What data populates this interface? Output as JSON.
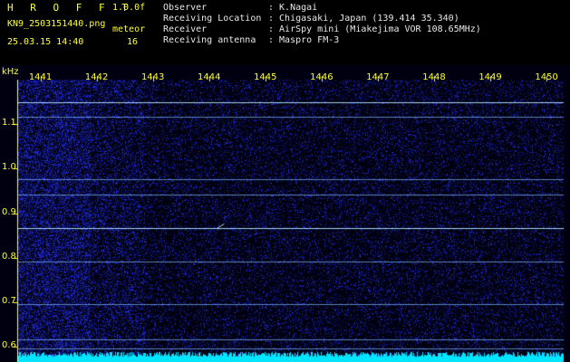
{
  "header": {
    "title": "H R O F F T",
    "version": "1.0.0f",
    "filename": "KN9_2503151440.png",
    "mode": "meteor",
    "datetime": "25.03.15 14:40",
    "count": "16",
    "info_labels": [
      "Observer",
      "Receiving Location",
      "Receiver",
      "Receiving antenna"
    ],
    "info_values": [
      ": K.Nagai",
      ": Chigasaki, Japan (139.414 35.340)",
      ": AirSpy mini (Miakejima VOR 108.65MHz)",
      ": Maspro FM-3"
    ]
  },
  "chart_data": {
    "type": "heatmap",
    "ylabel": "kHz",
    "y_ticks": [
      "1.1",
      "1.0",
      "0.9",
      "0.8",
      "0.7",
      "0.6"
    ],
    "y_tick_values": [
      1.1,
      1.0,
      0.9,
      0.8,
      0.7,
      0.6
    ],
    "x_ticks": [
      "1441",
      "1442",
      "1443",
      "1444",
      "1445",
      "1446",
      "1447",
      "1448",
      "1449",
      "1450"
    ],
    "x_tick_values": [
      1441,
      1442,
      1443,
      1444,
      1445,
      1446,
      1447,
      1448,
      1449,
      1450
    ],
    "xlim": [
      1440.6,
      1450.3
    ],
    "ylim": [
      0.57,
      1.2
    ],
    "carrier_lines_khz": [
      1.149,
      1.117,
      0.976,
      0.942,
      0.866,
      0.791,
      0.695,
      0.616,
      0.597
    ],
    "meteor_echo": {
      "time": 1444.2,
      "freq_khz": 0.87
    },
    "colors": {
      "background": "#000010",
      "noise": "#2a2ad0",
      "line": "#7fb8ff",
      "bright_line": "#b0e0ff",
      "bottom_band": "#00e5ff",
      "tick": "#ffff33"
    }
  }
}
